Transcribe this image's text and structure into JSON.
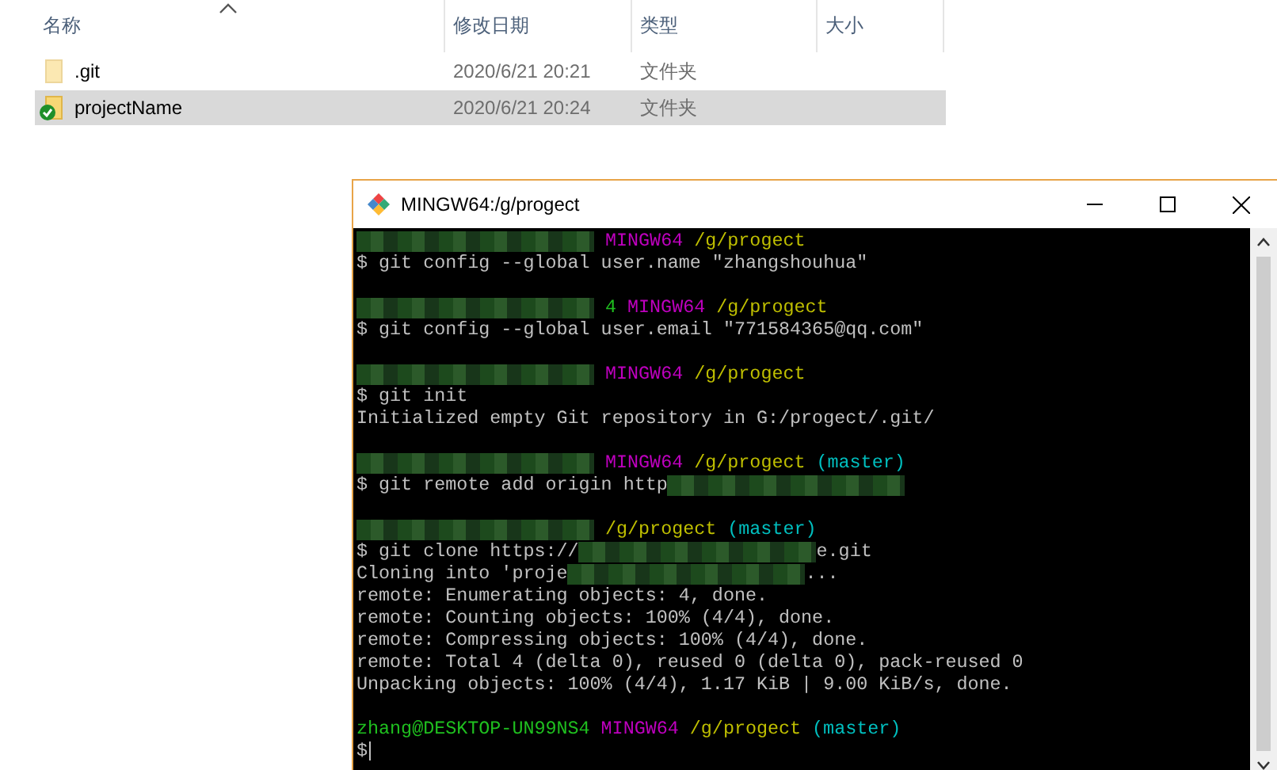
{
  "explorer": {
    "columns": [
      {
        "label": "名称",
        "sorted": true
      },
      {
        "label": "修改日期",
        "sorted": false
      },
      {
        "label": "类型",
        "sorted": false
      },
      {
        "label": "大小",
        "sorted": false
      }
    ],
    "rows": [
      {
        "name": ".git",
        "date": "2020/6/21 20:21",
        "type": "文件夹",
        "hidden": true,
        "synced": false,
        "selected": false
      },
      {
        "name": "projectName",
        "date": "2020/6/21 20:24",
        "type": "文件夹",
        "hidden": false,
        "synced": true,
        "selected": true
      }
    ]
  },
  "terminal": {
    "title": "MINGW64:/g/progect",
    "lines": [
      {
        "segments": [
          {
            "kind": "redacted"
          },
          {
            "kind": "system",
            "text": "MINGW64"
          },
          {
            "kind": "path",
            "text": "/g/progect"
          }
        ]
      },
      {
        "segments": [
          {
            "kind": "text",
            "text": "$ git config --global user.name \"zhangshouhua\""
          }
        ]
      },
      {
        "blank": true
      },
      {
        "segments": [
          {
            "kind": "redacted"
          },
          {
            "kind": "user",
            "text": "4"
          },
          {
            "kind": "system",
            "text": "MINGW64"
          },
          {
            "kind": "path",
            "text": "/g/progect"
          }
        ]
      },
      {
        "segments": [
          {
            "kind": "text",
            "text": "$ git config --global user.email \"771584365@qq.com\""
          }
        ]
      },
      {
        "blank": true
      },
      {
        "segments": [
          {
            "kind": "redacted"
          },
          {
            "kind": "system",
            "text": "MINGW64"
          },
          {
            "kind": "path",
            "text": "/g/progect"
          }
        ]
      },
      {
        "segments": [
          {
            "kind": "text",
            "text": "$ git init"
          }
        ]
      },
      {
        "segments": [
          {
            "kind": "text",
            "text": "Initialized empty Git repository in G:/progect/.git/"
          }
        ]
      },
      {
        "blank": true
      },
      {
        "segments": [
          {
            "kind": "redacted"
          },
          {
            "kind": "system",
            "text": "MINGW64"
          },
          {
            "kind": "path",
            "text": "/g/progect"
          },
          {
            "kind": "branch",
            "text": "(master)"
          }
        ]
      },
      {
        "segments": [
          {
            "kind": "text",
            "text": "$ git remote add origin http"
          },
          {
            "kind": "redacted"
          }
        ]
      },
      {
        "blank": true
      },
      {
        "segments": [
          {
            "kind": "redacted"
          },
          {
            "kind": "path",
            "text": "/g/progect"
          },
          {
            "kind": "branch",
            "text": "(master)"
          }
        ]
      },
      {
        "segments": [
          {
            "kind": "text",
            "text": "$ git clone https://"
          },
          {
            "kind": "redacted"
          },
          {
            "kind": "text",
            "text": "e.git"
          }
        ]
      },
      {
        "segments": [
          {
            "kind": "text",
            "text": "Cloning into 'proje"
          },
          {
            "kind": "redacted"
          },
          {
            "kind": "text",
            "text": "..."
          }
        ]
      },
      {
        "segments": [
          {
            "kind": "text",
            "text": "remote: Enumerating objects: 4, done."
          }
        ]
      },
      {
        "segments": [
          {
            "kind": "text",
            "text": "remote: Counting objects: 100% (4/4), done."
          }
        ]
      },
      {
        "segments": [
          {
            "kind": "text",
            "text": "remote: Compressing objects: 100% (4/4), done."
          }
        ]
      },
      {
        "segments": [
          {
            "kind": "text",
            "text": "remote: Total 4 (delta 0), reused 0 (delta 0), pack-reused 0"
          }
        ]
      },
      {
        "segments": [
          {
            "kind": "text",
            "text": "Unpacking objects: 100% (4/4), 1.17 KiB | 9.00 KiB/s, done."
          }
        ]
      },
      {
        "blank": true
      },
      {
        "segments": [
          {
            "kind": "user",
            "text": "zhang@DESKTOP-UN99NS4"
          },
          {
            "kind": "system",
            "text": "MINGW64"
          },
          {
            "kind": "path",
            "text": "/g/progect"
          },
          {
            "kind": "branch",
            "text": "(master)"
          }
        ]
      },
      {
        "segments": [
          {
            "kind": "text",
            "text": "$"
          },
          {
            "kind": "cursor"
          }
        ]
      }
    ]
  }
}
